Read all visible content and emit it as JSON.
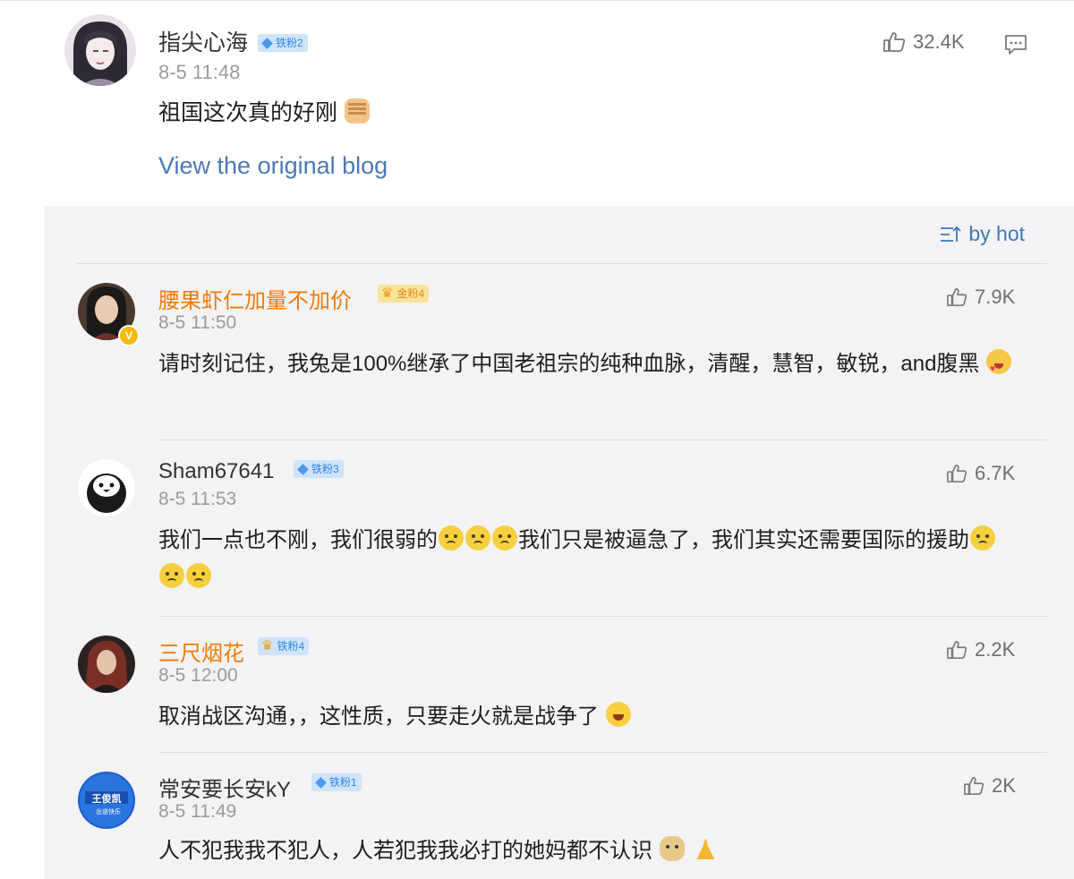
{
  "post": {
    "author": "指尖心海",
    "badge": "铁粉2",
    "time": "8-5 11:48",
    "text": "祖国这次真的好刚",
    "likes": "32.4K",
    "link": "View the original blog"
  },
  "sort_label": "by hot",
  "comments": [
    {
      "author": "腰果虾仁加量不加价",
      "badge": "金粉4",
      "time": "8-5 11:50",
      "text": "请时刻记住，我兔是100%继承了中国老祖宗的纯种血脉，清醒，慧智，敏锐，and腹黑",
      "likes": "7.9K"
    },
    {
      "author": "Sham67641",
      "badge": "铁粉3",
      "time": "8-5 11:53",
      "text_part1": "我们一点也不刚，我们很弱的",
      "text_part2": "我们只是被逼急了，我们其实还需要国际的援助",
      "likes": "6.7K"
    },
    {
      "author": "三尺烟花",
      "badge": "铁粉4",
      "time": "8-5 12:00",
      "text": "取消战区沟通，，这性质，只要走火就是战争了",
      "likes": "2.2K"
    },
    {
      "author": "常安要长安kY",
      "badge": "铁粉1",
      "time": "8-5 11:49",
      "text": "人不犯我我不犯人，人若犯我我必打的她妈都不认识",
      "likes": "2K",
      "avatar_text": "王俊凯",
      "avatar_subtext": "出道快乐"
    }
  ],
  "colors": {
    "link": "#4b79b6",
    "orange_name": "#f07a0a",
    "badge_blue": "#cfe4fb",
    "badge_gold": "#fce39b",
    "section_bg": "#f3f3f5"
  }
}
